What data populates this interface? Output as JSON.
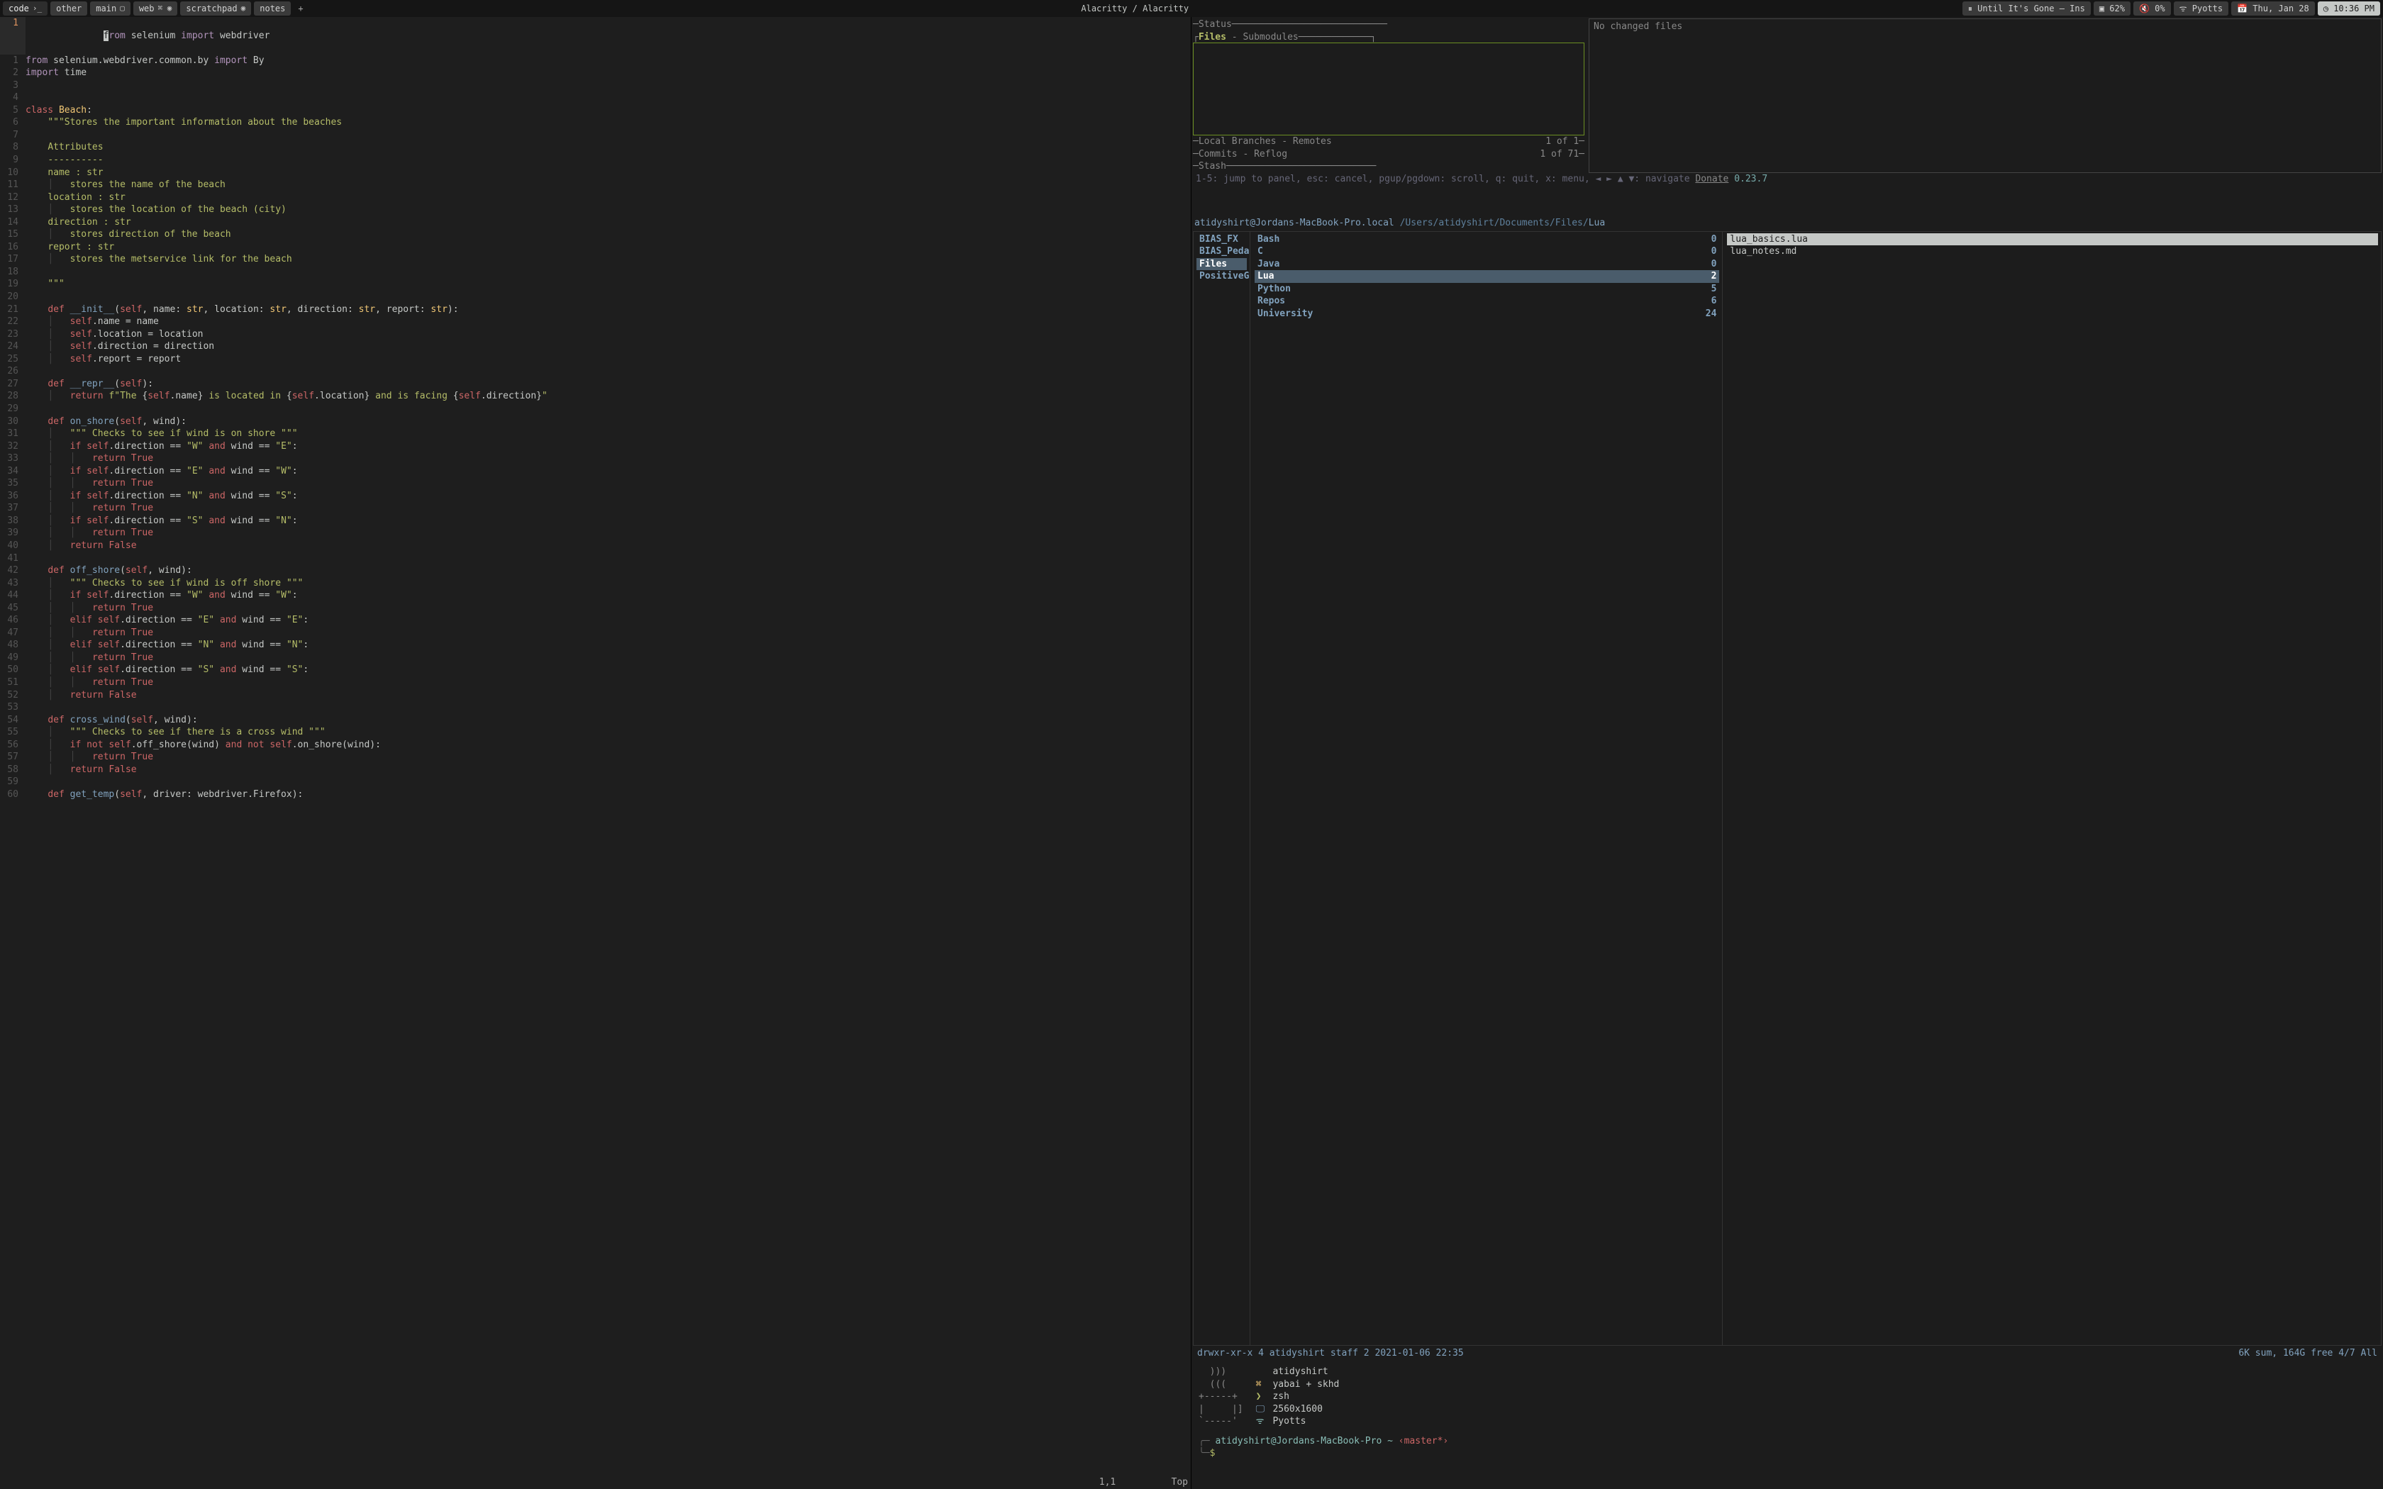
{
  "topbar": {
    "tabs": [
      {
        "label": "code",
        "icon": "›_"
      },
      {
        "label": "other",
        "icon": ""
      },
      {
        "label": "main",
        "icon": "▢"
      },
      {
        "label": "web",
        "icon": "⌘ ◉"
      },
      {
        "label": "scratchpad",
        "icon": "◉"
      },
      {
        "label": "notes",
        "icon": ""
      }
    ],
    "title": "Alacritty / Alacritty",
    "status": {
      "music": "⏸ Until It's Gone — Ins",
      "battery": "▣ 62%",
      "volume": "🔇 0%",
      "wifi": "ᯤ Pyotts",
      "date": "📅 Thu, Jan 28",
      "time": "◷ 10:36 PM"
    }
  },
  "editor": {
    "current_line_number": "1",
    "cursor_char": "f",
    "first_line_rest": "rom selenium import webdriver",
    "status_left": "1,1",
    "status_right": "Top",
    "lines": [
      {
        "n": 1,
        "html": "<span class='kw'>from</span> selenium.webdriver.common.by <span class='kw'>import</span> By"
      },
      {
        "n": 2,
        "html": "<span class='kw'>import</span> time"
      },
      {
        "n": 3,
        "html": ""
      },
      {
        "n": 4,
        "html": ""
      },
      {
        "n": 5,
        "html": "<span class='kw2'>class</span> <span class='type'>Beach</span>:"
      },
      {
        "n": 6,
        "html": "    <span class='str'>\"\"\"Stores the important information about the beaches</span>"
      },
      {
        "n": 7,
        "html": ""
      },
      {
        "n": 8,
        "html": "    <span class='str'>Attributes</span>"
      },
      {
        "n": 9,
        "html": "    <span class='str'>----------</span>"
      },
      {
        "n": 10,
        "html": "    <span class='str'>name : str</span>"
      },
      {
        "n": 11,
        "html": "    <span class='bar'>│   </span><span class='str'>stores the name of the beach</span>"
      },
      {
        "n": 12,
        "html": "    <span class='str'>location : str</span>"
      },
      {
        "n": 13,
        "html": "    <span class='bar'>│   </span><span class='str'>stores the location of the beach (city)</span>"
      },
      {
        "n": 14,
        "html": "    <span class='str'>direction : str</span>"
      },
      {
        "n": 15,
        "html": "    <span class='bar'>│   </span><span class='str'>stores direction of the beach</span>"
      },
      {
        "n": 16,
        "html": "    <span class='str'>report : str</span>"
      },
      {
        "n": 17,
        "html": "    <span class='bar'>│   </span><span class='str'>stores the metservice link for the beach</span>"
      },
      {
        "n": 18,
        "html": ""
      },
      {
        "n": 19,
        "html": "    <span class='str'>\"\"\"</span>"
      },
      {
        "n": 20,
        "html": ""
      },
      {
        "n": 21,
        "html": "    <span class='kw2'>def</span> <span class='fn'>__init__</span>(<span class='self'>self</span>, name: <span class='type'>str</span>, location: <span class='type'>str</span>, direction: <span class='type'>str</span>, report: <span class='type'>str</span>):"
      },
      {
        "n": 22,
        "html": "    <span class='bar'>│   </span><span class='self'>self</span>.name = name"
      },
      {
        "n": 23,
        "html": "    <span class='bar'>│   </span><span class='self'>self</span>.location = location"
      },
      {
        "n": 24,
        "html": "    <span class='bar'>│   </span><span class='self'>self</span>.direction = direction"
      },
      {
        "n": 25,
        "html": "    <span class='bar'>│   </span><span class='self'>self</span>.report = report"
      },
      {
        "n": 26,
        "html": ""
      },
      {
        "n": 27,
        "html": "    <span class='kw2'>def</span> <span class='fn'>__repr__</span>(<span class='self'>self</span>):"
      },
      {
        "n": 28,
        "html": "    <span class='bar'>│   </span><span class='kw2'>return</span> <span class='str'>f\"The </span>{<span class='self'>self</span>.name}<span class='str'> is located in </span>{<span class='self'>self</span>.location}<span class='str'> and is facing </span>{<span class='self'>self</span>.direction}<span class='str'>\"</span>"
      },
      {
        "n": 29,
        "html": ""
      },
      {
        "n": 30,
        "html": "    <span class='kw2'>def</span> <span class='fn'>on_shore</span>(<span class='self'>self</span>, wind):"
      },
      {
        "n": 31,
        "html": "    <span class='bar'>│   </span><span class='str'>\"\"\" Checks to see if wind is on shore \"\"\"</span>"
      },
      {
        "n": 32,
        "html": "    <span class='bar'>│   </span><span class='kw2'>if</span> <span class='self'>self</span>.direction == <span class='str'>\"W\"</span> <span class='kw2'>and</span> wind == <span class='str'>\"E\"</span>:"
      },
      {
        "n": 33,
        "html": "    <span class='bar'>│   │   </span><span class='kw2'>return</span> <span class='kw2'>True</span>"
      },
      {
        "n": 34,
        "html": "    <span class='bar'>│   </span><span class='kw2'>if</span> <span class='self'>self</span>.direction == <span class='str'>\"E\"</span> <span class='kw2'>and</span> wind == <span class='str'>\"W\"</span>:"
      },
      {
        "n": 35,
        "html": "    <span class='bar'>│   │   </span><span class='kw2'>return</span> <span class='kw2'>True</span>"
      },
      {
        "n": 36,
        "html": "    <span class='bar'>│   </span><span class='kw2'>if</span> <span class='self'>self</span>.direction == <span class='str'>\"N\"</span> <span class='kw2'>and</span> wind == <span class='str'>\"S\"</span>:"
      },
      {
        "n": 37,
        "html": "    <span class='bar'>│   │   </span><span class='kw2'>return</span> <span class='kw2'>True</span>"
      },
      {
        "n": 38,
        "html": "    <span class='bar'>│   </span><span class='kw2'>if</span> <span class='self'>self</span>.direction == <span class='str'>\"S\"</span> <span class='kw2'>and</span> wind == <span class='str'>\"N\"</span>:"
      },
      {
        "n": 39,
        "html": "    <span class='bar'>│   │   </span><span class='kw2'>return</span> <span class='kw2'>True</span>"
      },
      {
        "n": 40,
        "html": "    <span class='bar'>│   </span><span class='kw2'>return</span> <span class='kw2'>False</span>"
      },
      {
        "n": 41,
        "html": ""
      },
      {
        "n": 42,
        "html": "    <span class='kw2'>def</span> <span class='fn'>off_shore</span>(<span class='self'>self</span>, wind):"
      },
      {
        "n": 43,
        "html": "    <span class='bar'>│   </span><span class='str'>\"\"\" Checks to see if wind is off shore \"\"\"</span>"
      },
      {
        "n": 44,
        "html": "    <span class='bar'>│   </span><span class='kw2'>if</span> <span class='self'>self</span>.direction == <span class='str'>\"W\"</span> <span class='kw2'>and</span> wind == <span class='str'>\"W\"</span>:"
      },
      {
        "n": 45,
        "html": "    <span class='bar'>│   │   </span><span class='kw2'>return</span> <span class='kw2'>True</span>"
      },
      {
        "n": 46,
        "html": "    <span class='bar'>│   </span><span class='kw2'>elif</span> <span class='self'>self</span>.direction == <span class='str'>\"E\"</span> <span class='kw2'>and</span> wind == <span class='str'>\"E\"</span>:"
      },
      {
        "n": 47,
        "html": "    <span class='bar'>│   │   </span><span class='kw2'>return</span> <span class='kw2'>True</span>"
      },
      {
        "n": 48,
        "html": "    <span class='bar'>│   </span><span class='kw2'>elif</span> <span class='self'>self</span>.direction == <span class='str'>\"N\"</span> <span class='kw2'>and</span> wind == <span class='str'>\"N\"</span>:"
      },
      {
        "n": 49,
        "html": "    <span class='bar'>│   │   </span><span class='kw2'>return</span> <span class='kw2'>True</span>"
      },
      {
        "n": 50,
        "html": "    <span class='bar'>│   </span><span class='kw2'>elif</span> <span class='self'>self</span>.direction == <span class='str'>\"S\"</span> <span class='kw2'>and</span> wind == <span class='str'>\"S\"</span>:"
      },
      {
        "n": 51,
        "html": "    <span class='bar'>│   │   </span><span class='kw2'>return</span> <span class='kw2'>True</span>"
      },
      {
        "n": 52,
        "html": "    <span class='bar'>│   </span><span class='kw2'>return</span> <span class='kw2'>False</span>"
      },
      {
        "n": 53,
        "html": ""
      },
      {
        "n": 54,
        "html": "    <span class='kw2'>def</span> <span class='fn'>cross_wind</span>(<span class='self'>self</span>, wind):"
      },
      {
        "n": 55,
        "html": "    <span class='bar'>│   </span><span class='str'>\"\"\" Checks to see if there is a cross wind \"\"\"</span>"
      },
      {
        "n": 56,
        "html": "    <span class='bar'>│   </span><span class='kw2'>if</span> <span class='kw2'>not</span> <span class='self'>self</span>.off_shore(wind) <span class='kw2'>and</span> <span class='kw2'>not</span> <span class='self'>self</span>.on_shore(wind):"
      },
      {
        "n": 57,
        "html": "    <span class='bar'>│   │   </span><span class='kw2'>return</span> <span class='kw2'>True</span>"
      },
      {
        "n": 58,
        "html": "    <span class='bar'>│   </span><span class='kw2'>return</span> <span class='kw2'>False</span>"
      },
      {
        "n": 59,
        "html": ""
      },
      {
        "n": 60,
        "html": "    <span class='kw2'>def</span> <span class='fn'>get_temp</span>(<span class='self'>self</span>, driver: webdriver.Firefox):"
      }
    ]
  },
  "lazygit": {
    "status_label": "Status",
    "files_label": "Files",
    "submodules_label": "Submodules",
    "no_changed": "No changed files",
    "branches_line_left": "Local Branches",
    "branches_line_mid": "Remotes",
    "branches_line_right": "1 of 1",
    "commits_line_left": "Commits",
    "commits_line_mid": "Reflog",
    "commits_line_right": "1 of 71",
    "stash_label": "Stash",
    "hints": "1-5: jump to panel, esc: cancel, pgup/pgdown: scroll, q: quit, x: menu, ◄ ► ▲ ▼: navigate ",
    "donate": "Donate",
    "version": "0.23.7"
  },
  "pathline": {
    "userhost": "atidyshirt@Jordans-MacBook-Pro.local",
    "path_prefix": "/Users/atidyshirt/Documents/Files/",
    "path_leaf": "Lua"
  },
  "ranger": {
    "col1": [
      {
        "label": "BIAS_FX"
      },
      {
        "label": "BIAS_Pedal"
      },
      {
        "label": "Files",
        "selected": true
      },
      {
        "label": "PositiveG~"
      }
    ],
    "col2": [
      {
        "label": "Bash",
        "count": "0"
      },
      {
        "label": "C",
        "count": "0"
      },
      {
        "label": "Java",
        "count": "0"
      },
      {
        "label": "Lua",
        "count": "2",
        "selected": true
      },
      {
        "label": "Python",
        "count": "5"
      },
      {
        "label": "Repos",
        "count": "6"
      },
      {
        "label": "University",
        "count": "24"
      }
    ],
    "col3": [
      {
        "label": "lua_basics.lua",
        "highlight": true
      },
      {
        "label": "lua_notes.md"
      }
    ],
    "status_left": "drwxr-xr-x 4 atidyshirt staff 2 2021-01-06 22:35",
    "status_right": "6K sum, 164G free  4/7  All"
  },
  "neofetch": {
    "art": "  )))\n  (((\n+-----+\n|     |]\n`-----'",
    "rows": [
      {
        "ico": "",
        "cls": "red",
        "text": "atidyshirt"
      },
      {
        "ico": "⌘",
        "cls": "yel",
        "text": "yabai + skhd"
      },
      {
        "ico": "❯",
        "cls": "grn",
        "text": "zsh"
      },
      {
        "ico": "🖵",
        "cls": "blu",
        "text": "2560x1600"
      },
      {
        "ico": "ᯤ",
        "cls": "cyn",
        "text": "Pyotts"
      }
    ]
  },
  "prompt": {
    "userhost": "atidyshirt@Jordans-MacBook-Pro",
    "cwd": "~",
    "branch": "‹master*›",
    "dollar": "$"
  }
}
